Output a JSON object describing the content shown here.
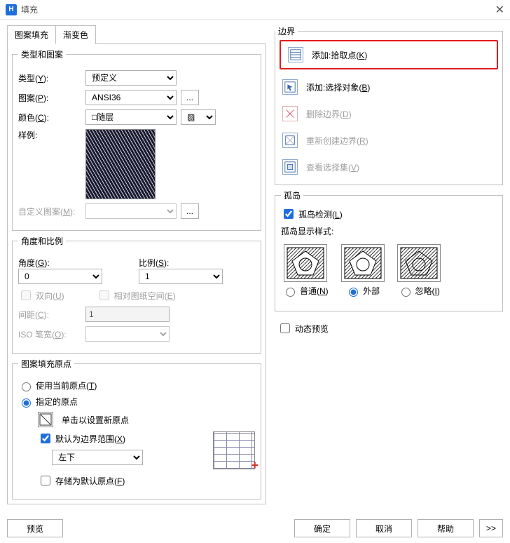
{
  "title": "填充",
  "tabs": {
    "hatch": "图案填充",
    "gradient": "渐变色"
  },
  "type_pattern": {
    "legend": "类型和图案",
    "type_label": "类型(Y):",
    "type_value": "预定义",
    "pattern_label": "图案(P):",
    "pattern_value": "ANSI36",
    "more": "...",
    "color_label": "颜色(C):",
    "color_value": "□随层",
    "sample_label": "样例:",
    "custom_label": "自定义图案(M):",
    "custom_more": "..."
  },
  "angle_scale": {
    "legend": "角度和比例",
    "angle_label": "角度(G):",
    "angle_value": "0",
    "scale_label": "比例(S):",
    "scale_value": "1",
    "double_label": "双向(U)",
    "rel_paper_label": "相对图纸空间(E)",
    "spacing_label": "间距(C):",
    "spacing_value": "1",
    "iso_label": "ISO 笔宽(O):"
  },
  "origin": {
    "legend": "图案填充原点",
    "use_current": "使用当前原点(T)",
    "specified": "指定的原点",
    "click_set": "单击以设置新原点",
    "default_extents": "默认为边界范围(X)",
    "pos_value": "左下",
    "store_default": "存储为默认原点(F)"
  },
  "boundary": {
    "legend": "边界",
    "add_pick": "添加:拾取点(K)",
    "add_select": "添加:选择对象(B)",
    "remove": "删除边界(D)",
    "recreate": "重新创建边界(R)",
    "view_sel": "查看选择集(V)"
  },
  "island": {
    "legend": "孤岛",
    "detection": "孤岛检测(L)",
    "display_style": "孤岛显示样式:",
    "normal": "普通(N)",
    "outer": "外部",
    "ignore": "忽略(I)"
  },
  "dynamic_preview": "动态预览",
  "buttons": {
    "preview": "预览",
    "ok": "确定",
    "cancel": "取消",
    "help": "帮助",
    "expand": ">>"
  }
}
